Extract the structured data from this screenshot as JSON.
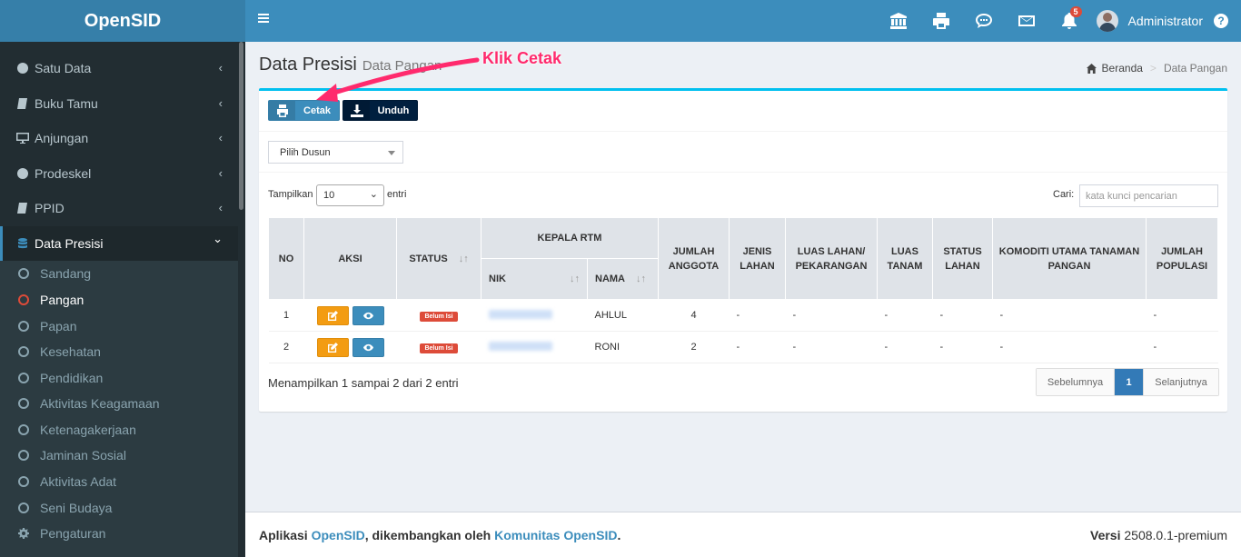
{
  "app": {
    "title": "OpenSID"
  },
  "header": {
    "user_name": "Administrator",
    "notification_count": "5",
    "icons": [
      "bank-icon",
      "print-icon",
      "chat-icon",
      "mail-icon",
      "bell-icon",
      "help-icon"
    ],
    "help_glyph": "?"
  },
  "sidebar": {
    "items": [
      {
        "label": "Satu Data",
        "icon": "globe-icon"
      },
      {
        "label": "Buku Tamu",
        "icon": "book-icon"
      },
      {
        "label": "Anjungan",
        "icon": "monitor-icon"
      },
      {
        "label": "Prodeskel",
        "icon": "globe-icon"
      },
      {
        "label": "PPID",
        "icon": "book-icon"
      },
      {
        "label": "Data Presisi",
        "icon": "database-icon"
      }
    ],
    "submenu": [
      "Sandang",
      "Pangan",
      "Papan",
      "Kesehatan",
      "Pendidikan",
      "Aktivitas Keagamaan",
      "Ketenagakerjaan",
      "Jaminan Sosial",
      "Aktivitas Adat",
      "Seni Budaya",
      "Pengaturan"
    ],
    "chevron_left": "‹",
    "chevron_down": "⌄"
  },
  "page": {
    "title": "Data Presisi",
    "subtitle": "Data Pangan",
    "breadcrumb": {
      "home": "Beranda",
      "sep": ">",
      "current": "Data Pangan"
    }
  },
  "toolbar": {
    "print_label": "Cetak",
    "download_label": "Unduh"
  },
  "filter": {
    "dusun_placeholder": "Pilih Dusun"
  },
  "datatable": {
    "show_label": "Tampilkan",
    "length_value": "10",
    "entries_label": "entri",
    "search_label": "Cari:",
    "search_placeholder": "kata kunci pencarian",
    "sort_glyph": "↓↑",
    "headers": {
      "no": "NO",
      "aksi": "AKSI",
      "status": "STATUS",
      "kepala_rtm": "KEPALA RTM",
      "nik": "NIK",
      "nama": "NAMA",
      "jumlah_anggota": "JUMLAH ANGGOTA",
      "jenis_lahan": "JENIS LAHAN",
      "luas_lahan": "LUAS LAHAN/ PEKARANGAN",
      "luas_tanam": "LUAS TANAM",
      "status_lahan": "STATUS LAHAN",
      "komoditi": "KOMODITI UTAMA TANAMAN PANGAN",
      "jumlah_populasi": "JUMLAH POPULASI"
    },
    "rows": [
      {
        "no": "1",
        "status": "Belum Isi",
        "nama": "AHLUL",
        "jumlah_anggota": "4",
        "jenis_lahan": "-",
        "luas_lahan": "-",
        "luas_tanam": "-",
        "status_lahan": "-",
        "komoditi": "-",
        "jumlah_populasi": "-"
      },
      {
        "no": "2",
        "status": "Belum Isi",
        "nama": "RONI",
        "jumlah_anggota": "2",
        "jenis_lahan": "-",
        "luas_lahan": "-",
        "luas_tanam": "-",
        "status_lahan": "-",
        "komoditi": "-",
        "jumlah_populasi": "-"
      }
    ],
    "info": "Menampilkan 1 sampai 2 dari 2 entri",
    "pagination": {
      "prev": "Sebelumnya",
      "current": "1",
      "next": "Selanjutnya"
    }
  },
  "footer": {
    "prefix": "Aplikasi",
    "app_link": "OpenSID",
    "middle": ", dikembangkan oleh",
    "community_link": "Komunitas OpenSID",
    "suffix": ".",
    "version_label": "Versi",
    "version": "2508.0.1-premium"
  },
  "annotation": {
    "text": "Klik Cetak",
    "color": "#ff2a6d"
  },
  "colors": {
    "primary": "#3c8dbc",
    "sidebar": "#222d32",
    "accent_top": "#00c0ef",
    "danger": "#dd4b39",
    "warning": "#f39c12"
  }
}
